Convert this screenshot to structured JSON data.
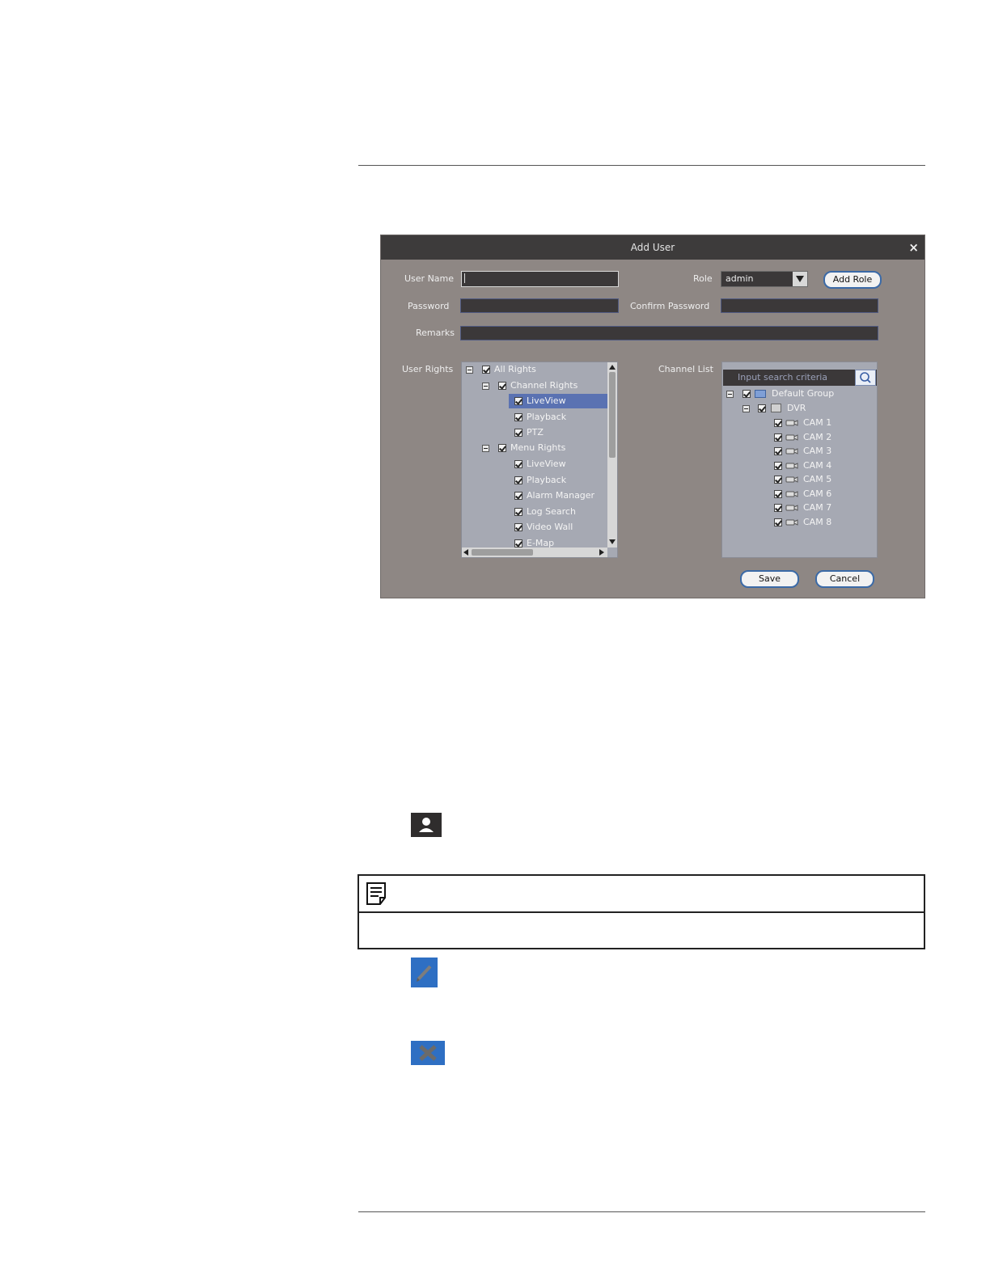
{
  "dialog": {
    "title": "Add User",
    "close_symbol": "×",
    "user_name_label": "User Name",
    "user_name_value": "",
    "role_label": "Role",
    "role_value": "admin",
    "add_role_label": "Add Role",
    "password_label": "Password",
    "password_value": "",
    "confirm_password_label": "Confirm Password",
    "confirm_password_value": "",
    "remarks_label": "Remarks",
    "remarks_value": "",
    "user_rights_label": "User Rights",
    "channel_list_label": "Channel List",
    "save_label": "Save",
    "cancel_label": "Cancel"
  },
  "user_rights": [
    {
      "label": "All Rights",
      "checked": true
    },
    {
      "label": "Channel Rights",
      "checked": true
    },
    {
      "label": "LiveView",
      "checked": true,
      "selected": true
    },
    {
      "label": "Playback",
      "checked": true
    },
    {
      "label": "PTZ",
      "checked": true
    },
    {
      "label": "Menu Rights",
      "checked": true
    },
    {
      "label": "LiveView",
      "checked": true
    },
    {
      "label": "Playback",
      "checked": true
    },
    {
      "label": "Alarm Manager",
      "checked": true
    },
    {
      "label": "Log Search",
      "checked": true
    },
    {
      "label": "Video Wall",
      "checked": true
    },
    {
      "label": "E-Map",
      "checked": true
    }
  ],
  "channel_list": {
    "search_placeholder": "Input search criteria",
    "group": "Default Group",
    "device": "DVR",
    "cameras": [
      "CAM 1",
      "CAM 2",
      "CAM 3",
      "CAM 4",
      "CAM 5",
      "CAM 6",
      "CAM 7",
      "CAM 8"
    ]
  },
  "icons": {
    "user": "user-icon",
    "note": "note-icon",
    "edit": "edit-icon",
    "delete": "delete-icon"
  },
  "colors": {
    "dialog_bg": "#8e8784",
    "title_bar": "#3d3b3b",
    "tree_bg": "#a6a9b3",
    "selection": "#5a72b2",
    "button_border": "#3b6aa7",
    "icon_blue": "#2e6fc3"
  }
}
